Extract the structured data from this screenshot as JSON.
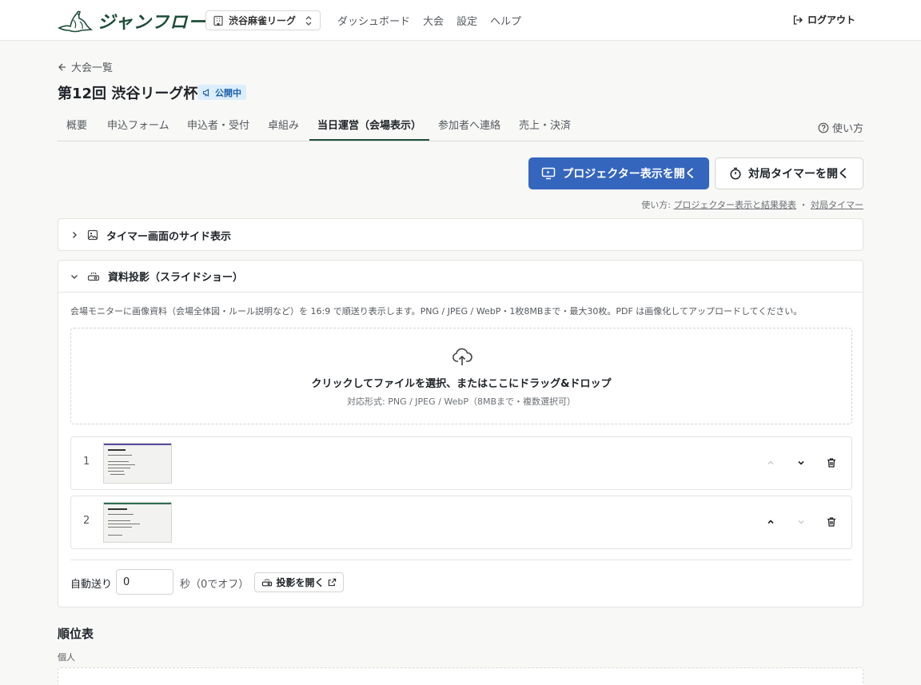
{
  "header": {
    "logo_text": "ジャンフロー",
    "org_name": "渋谷麻雀リーグ",
    "nav": [
      "ダッシュボード",
      "大会",
      "設定",
      "ヘルプ"
    ],
    "logout_label": "ログアウト"
  },
  "breadcrumb": {
    "back_label": "大会一覧"
  },
  "page": {
    "title": "第12回 渋谷リーグ杯",
    "status_badge": "公開中"
  },
  "tabs": [
    {
      "label": "概要",
      "active": false
    },
    {
      "label": "申込フォーム",
      "active": false
    },
    {
      "label": "申込者・受付",
      "active": false
    },
    {
      "label": "卓組み",
      "active": false
    },
    {
      "label": "当日運営（会場表示）",
      "active": true
    },
    {
      "label": "参加者へ連絡",
      "active": false
    },
    {
      "label": "売上・決済",
      "active": false
    }
  ],
  "howto_label": "使い方",
  "actions": {
    "projector_label": "プロジェクター表示を開く",
    "timer_label": "対局タイマーを開く",
    "help_prefix": "使い方:",
    "help_link_1": "プロジェクター表示と結果発表",
    "help_sep": "・",
    "help_link_2": "対局タイマー"
  },
  "panel_timer_side": {
    "title": "タイマー画面のサイド表示",
    "expanded": false
  },
  "panel_slideshow": {
    "title": "資料投影（スライドショー）",
    "expanded": true,
    "description": "会場モニターに画像資料（会場全体図・ルール説明など）を 16:9 で順送り表示します。PNG / JPEG / WebP・1枚8MBまで・最大30枚。PDF は画像化してアップロードしてください。",
    "dropzone_main": "クリックしてファイルを選択、またはここにドラッグ&ドロップ",
    "dropzone_sub": "対応形式: PNG / JPEG / WebP（8MBまで・複数選択可）",
    "slides": [
      {
        "number": "1",
        "can_up": false,
        "can_down": true
      },
      {
        "number": "2",
        "can_up": true,
        "can_down": false
      }
    ],
    "auto_advance_label": "自動送り",
    "auto_advance_value": "0",
    "auto_advance_unit": "秒（0でオフ）",
    "open_projection_label": "投影を開く"
  },
  "standings": {
    "title": "順位表",
    "sub": "個人"
  },
  "colors": {
    "brand": "#1f4d3a",
    "primary": "#3566bd",
    "badge_bg": "#dceefd",
    "badge_fg": "#1d5fa8"
  }
}
